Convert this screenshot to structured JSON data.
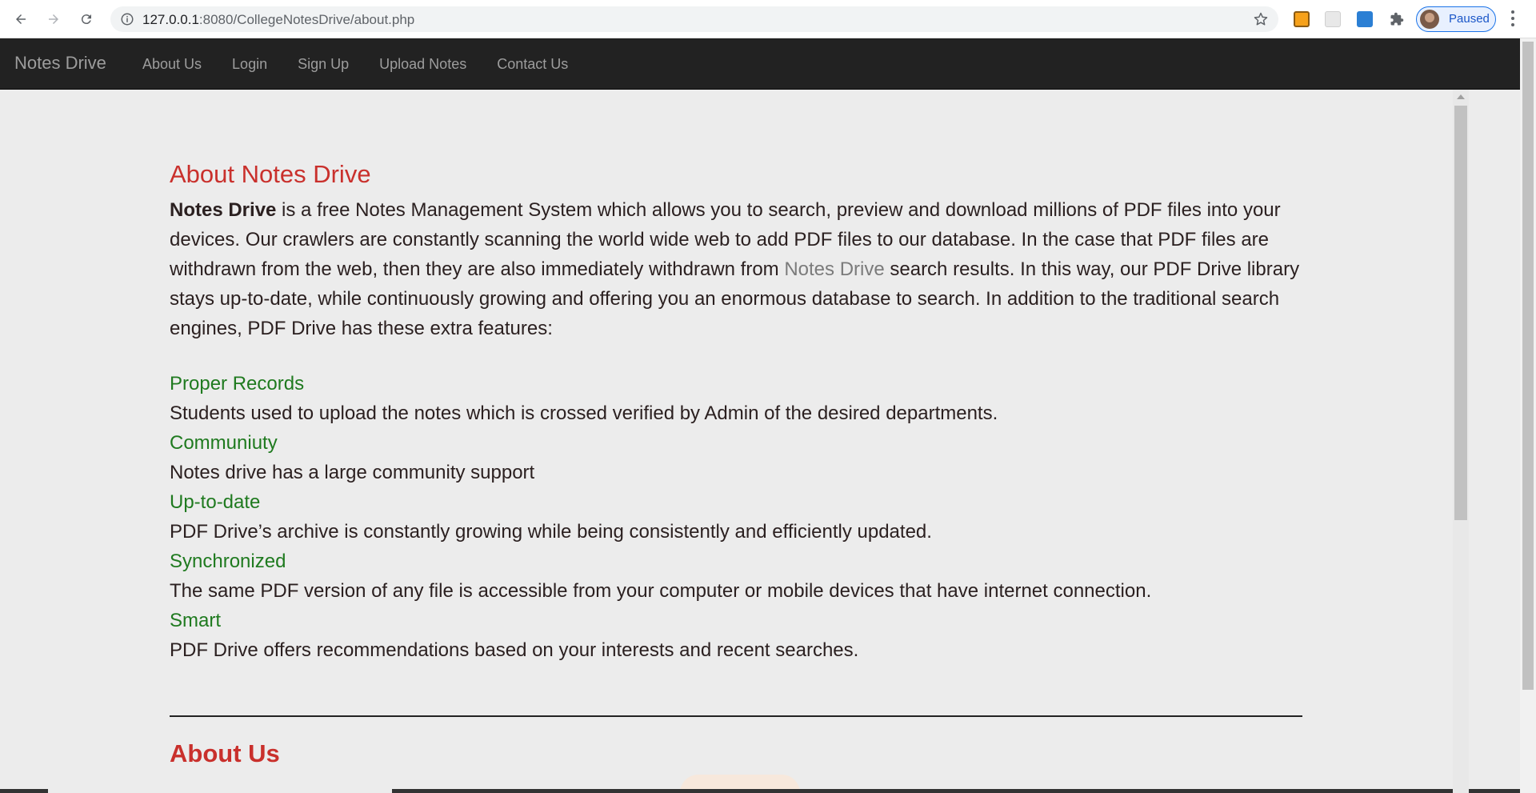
{
  "browser": {
    "url_host": "127.0.0.1",
    "url_rest": ":8080/CollegeNotesDrive/about.php",
    "profile_label": "Paused"
  },
  "navbar": {
    "brand": "Notes Drive",
    "links": [
      "About Us",
      "Login",
      "Sign Up",
      "Upload Notes",
      "Contact Us"
    ]
  },
  "about": {
    "heading": "About Notes Drive",
    "intro_bold": "Notes Drive",
    "intro_part1": " is a free Notes Management System which allows you to search, preview and download millions of PDF files into your devices. Our crawlers are constantly scanning the world wide web to add PDF files to our database. In the case that PDF files are withdrawn from the web, then they are also immediately withdrawn from ",
    "intro_link": "Notes Drive",
    "intro_part2": " search results. In this way, our PDF Drive library stays up-to-date, while continuously growing and offering you an enormous database to search. In addition to the traditional search engines, PDF Drive has these extra features:"
  },
  "features": [
    {
      "title": "Proper Records",
      "desc": "Students used to upload the notes which is crossed verified by Admin of the desired departments."
    },
    {
      "title": "Communiuty",
      "desc": "Notes drive has a large community support"
    },
    {
      "title": "Up-to-date",
      "desc": "PDF Drive’s archive is constantly growing while being consistently and efficiently updated."
    },
    {
      "title": "Synchronized",
      "desc": "The same PDF version of any file is accessible from your computer or mobile devices that have internet connection."
    },
    {
      "title": "Smart",
      "desc": "PDF Drive offers recommendations based on your interests and recent searches."
    }
  ],
  "about_us": {
    "heading": "About Us"
  },
  "icons": [
    "back-arrow-icon",
    "forward-arrow-icon",
    "reload-icon",
    "info-icon",
    "star-icon",
    "puzzle-icon"
  ]
}
